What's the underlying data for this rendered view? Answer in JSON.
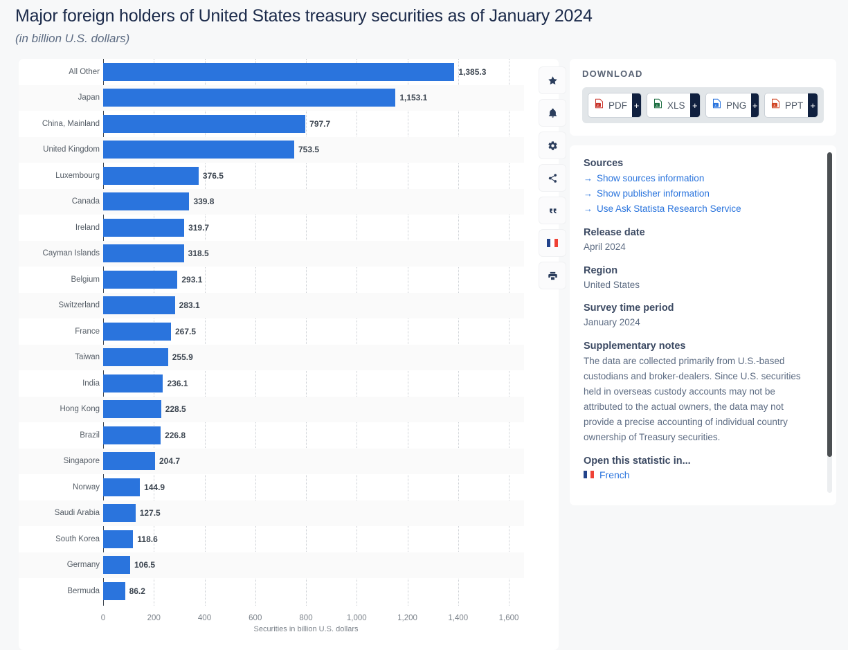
{
  "header": {
    "title": "Major foreign holders of United States treasury securities as of January 2024",
    "subtitle": "(in billion U.S. dollars)"
  },
  "chart_data": {
    "type": "bar",
    "orientation": "horizontal",
    "title": "Major foreign holders of United States treasury securities as of January 2024",
    "subtitle": "(in billion U.S. dollars)",
    "xlabel": "Securities in billion U.S. dollars",
    "ylabel": "",
    "xlim": [
      0,
      1600
    ],
    "xticks": [
      0,
      200,
      400,
      600,
      800,
      1000,
      1200,
      1400,
      1600
    ],
    "xtick_labels": [
      "0",
      "200",
      "400",
      "600",
      "800",
      "1,000",
      "1,200",
      "1,400",
      "1,600"
    ],
    "grid": true,
    "legend": false,
    "bar_color": "#2a74dd",
    "categories": [
      "All Other",
      "Japan",
      "China, Mainland",
      "United Kingdom",
      "Luxembourg",
      "Canada",
      "Ireland",
      "Cayman Islands",
      "Belgium",
      "Switzerland",
      "France",
      "Taiwan",
      "India",
      "Hong Kong",
      "Brazil",
      "Singapore",
      "Norway",
      "Saudi Arabia",
      "South Korea",
      "Germany",
      "Bermuda"
    ],
    "values": [
      1385.3,
      1153.1,
      797.7,
      753.5,
      376.5,
      339.8,
      319.7,
      318.5,
      293.1,
      283.1,
      267.5,
      255.9,
      236.1,
      228.5,
      226.8,
      204.7,
      144.9,
      127.5,
      118.6,
      106.5,
      86.2
    ],
    "value_labels": [
      "1,385.3",
      "1,153.1",
      "797.7",
      "753.5",
      "376.5",
      "339.8",
      "319.7",
      "318.5",
      "293.1",
      "283.1",
      "267.5",
      "255.9",
      "236.1",
      "228.5",
      "226.8",
      "204.7",
      "144.9",
      "127.5",
      "118.6",
      "106.5",
      "86.2"
    ]
  },
  "toolbar": {
    "items": [
      {
        "icon": "star-icon",
        "name": "favorite-button"
      },
      {
        "icon": "bell-icon",
        "name": "alert-button"
      },
      {
        "icon": "gear-icon",
        "name": "settings-button"
      },
      {
        "icon": "share-icon",
        "name": "share-button"
      },
      {
        "icon": "quote-icon",
        "name": "cite-button"
      },
      {
        "icon": "french-flag-icon",
        "name": "language-button"
      },
      {
        "icon": "printer-icon",
        "name": "print-button"
      }
    ]
  },
  "download": {
    "heading": "DOWNLOAD",
    "plus": "+",
    "buttons": [
      {
        "label": "PDF",
        "color": "#c8342b"
      },
      {
        "label": "XLS",
        "color": "#1d6f42"
      },
      {
        "label": "PNG",
        "color": "#2a74dd"
      },
      {
        "label": "PPT",
        "color": "#d04423"
      }
    ]
  },
  "meta": {
    "sources_heading": "Sources",
    "links": [
      "Show sources information",
      "Show publisher information",
      "Use Ask Statista Research Service"
    ],
    "arrow": "→",
    "release_date_heading": "Release date",
    "release_date_value": "April 2024",
    "region_heading": "Region",
    "region_value": "United States",
    "survey_heading": "Survey time period",
    "survey_value": "January 2024",
    "notes_heading": "Supplementary notes",
    "notes_text": "The data are collected primarily from U.S.-based custodians and broker-dealers. Since U.S. securities held in overseas custody accounts may not be attributed to the actual owners, the data may not provide a precise accounting of individual country ownership of Treasury securities.",
    "open_in_heading": "Open this statistic in...",
    "language_label": "French"
  }
}
